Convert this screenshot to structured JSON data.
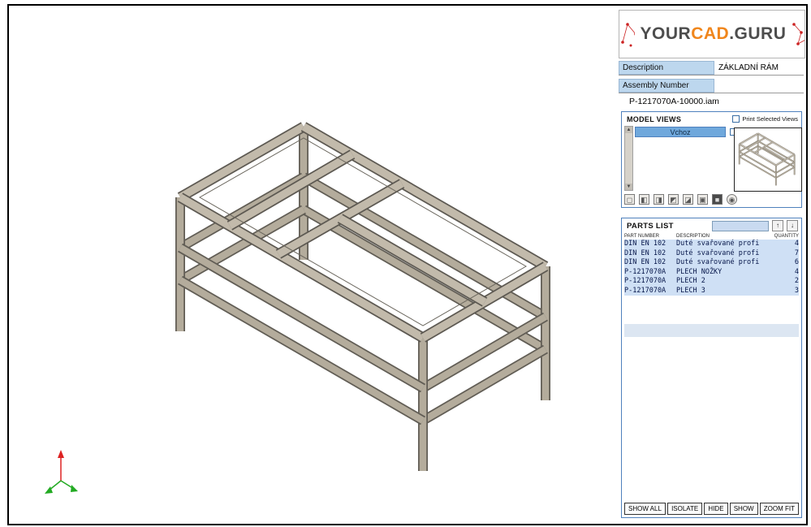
{
  "colors": {
    "accent_orange": "#f0861c",
    "panel_border": "#4f81bd",
    "label_blue": "#bdd7ee",
    "row_blue": "#cfe0f5",
    "selected_blue": "#6fa8dc",
    "beam_tan": "#b4ac9c"
  },
  "logo": {
    "part1": "YOUR",
    "part2": "CAD",
    "part3": ".GURU"
  },
  "info": {
    "description_label": "Description",
    "description_value": "ZÁKLADNÍ RÁM",
    "assembly_label": "Assembly Number",
    "assembly_value": "",
    "file_name": "P-1217070A-10000.iam"
  },
  "model_views": {
    "title": "MODEL VIEWS",
    "print_label": "Print Selected Views",
    "view_name": "Vchoz",
    "scroll_up": "▲",
    "scroll_down": "▼",
    "icons": [
      "◻",
      "◧",
      "◨",
      "◩",
      "◪",
      "▣",
      "■",
      "◉"
    ]
  },
  "parts_list": {
    "title": "PARTS LIST",
    "sort_up": "↑",
    "sort_down": "↓",
    "columns": [
      "PART NUMBER",
      "DESCRIPTION",
      "QUANTITY"
    ],
    "rows": [
      {
        "part": "DIN EN 102",
        "desc": "Duté svařované profi",
        "qty": "4"
      },
      {
        "part": "DIN EN 102",
        "desc": "Duté svařované profi",
        "qty": "7"
      },
      {
        "part": "DIN EN 102",
        "desc": "Duté svařované profi",
        "qty": "6"
      },
      {
        "part": "P-1217070A",
        "desc": "PLECH NOŽKY",
        "qty": "4"
      },
      {
        "part": "P-1217070A",
        "desc": "PLECH 2",
        "qty": "2"
      },
      {
        "part": "P-1217070A",
        "desc": "PLECH 3",
        "qty": "3"
      }
    ]
  },
  "actions": {
    "show_all": "SHOW ALL",
    "isolate": "ISOLATE",
    "hide": "HIDE",
    "show": "SHOW",
    "zoom_fit": "ZOOM FIT"
  }
}
